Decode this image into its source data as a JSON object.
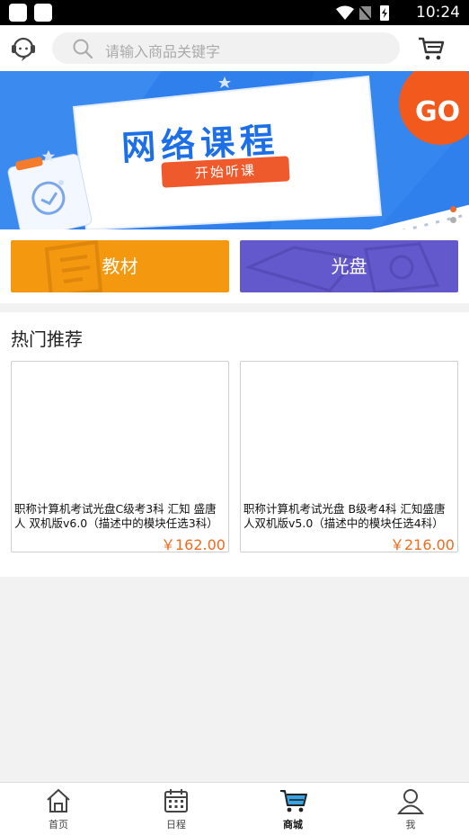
{
  "status_bar": {
    "time": "10:24"
  },
  "search": {
    "placeholder": "请输入商品关键字"
  },
  "banner": {
    "title": "网络课程",
    "button": "开始听课",
    "go": "GO"
  },
  "categories": [
    {
      "label": "教材",
      "color": "#f4980f"
    },
    {
      "label": "光盘",
      "color": "#6358cc"
    }
  ],
  "hot": {
    "title": "热门推荐",
    "products": [
      {
        "name": "职称计算机考试光盘C级考3科 汇知 盛唐人 双机版v6.0（描述中的模块任选3科）",
        "price": "￥162.00"
      },
      {
        "name": "职称计算机考试光盘 B级考4科 汇知盛唐人双机版v5.0（描述中的模块任选4科）",
        "price": "￥216.00"
      }
    ]
  },
  "tabs": [
    {
      "label": "首页",
      "icon": "home-icon"
    },
    {
      "label": "日程",
      "icon": "calendar-icon"
    },
    {
      "label": "商城",
      "icon": "cart-icon",
      "active": true
    },
    {
      "label": "我",
      "icon": "user-icon"
    }
  ],
  "colors": {
    "accent": "#f06a1e",
    "brand_blue": "#2d7be9"
  }
}
